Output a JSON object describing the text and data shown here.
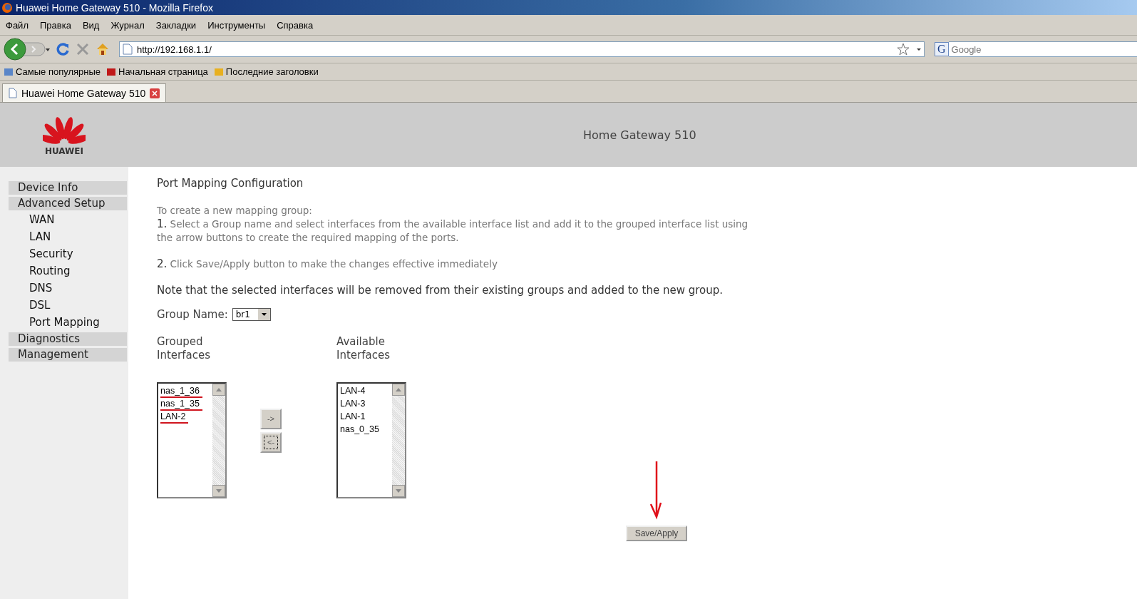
{
  "window": {
    "title": "Huawei Home Gateway 510 - Mozilla Firefox"
  },
  "menu": [
    "Файл",
    "Правка",
    "Вид",
    "Журнал",
    "Закладки",
    "Инструменты",
    "Справка"
  ],
  "address": {
    "value": "http://192.168.1.1/"
  },
  "search": {
    "placeholder": "Google",
    "engine": "G"
  },
  "bookmarks": [
    "Самые популярные",
    "Начальная страница",
    "Последние заголовки"
  ],
  "tabs": [
    {
      "label": "Huawei Home Gateway 510",
      "selected": true
    }
  ],
  "header": {
    "logo": "HUAWEI",
    "title": "Home Gateway 510"
  },
  "sidebar": {
    "items": [
      {
        "label": "Device Info"
      },
      {
        "label": "Advanced Setup",
        "children": [
          {
            "label": "WAN"
          },
          {
            "label": "LAN"
          },
          {
            "label": "Security"
          },
          {
            "label": "Routing"
          },
          {
            "label": "DNS"
          },
          {
            "label": "DSL"
          },
          {
            "label": "Port Mapping"
          }
        ]
      },
      {
        "label": "Diagnostics"
      },
      {
        "label": "Management"
      }
    ]
  },
  "content": {
    "title": "Port Mapping Configuration",
    "intro": "To create a new mapping group:",
    "steps": [
      "**1.** Select a Group name and select interfaces from the available interface list and add it to the grouped interface list using the arrow buttons to create the required mapping of the ports.",
      "**2.** Click Save/Apply button to make the changes effective immediately"
    ],
    "note": "Note that the selected interfaces will be removed from their existing groups and added to the new group.",
    "group_name": {
      "label": "Group Name:",
      "value": "br1"
    },
    "grouped": {
      "heading_lines": [
        "Grouped",
        "Interfaces"
      ],
      "items": [
        {
          "label": "nas_1_36",
          "marked": true
        },
        {
          "label": "nas_1_35",
          "marked": true
        },
        {
          "label": "LAN-2",
          "marked": true
        }
      ]
    },
    "move_buttons": [
      {
        "label": "->",
        "focused": false
      },
      {
        "label": "<-",
        "focused": true
      }
    ],
    "available": {
      "heading_lines": [
        "Available",
        "Interfaces"
      ],
      "items": [
        {
          "label": "LAN-4",
          "marked": false
        },
        {
          "label": "LAN-3",
          "marked": false
        },
        {
          "label": "LAN-1",
          "marked": false
        },
        {
          "label": "nas_0_35",
          "marked": false
        }
      ]
    },
    "save_button": "Save/Apply"
  }
}
